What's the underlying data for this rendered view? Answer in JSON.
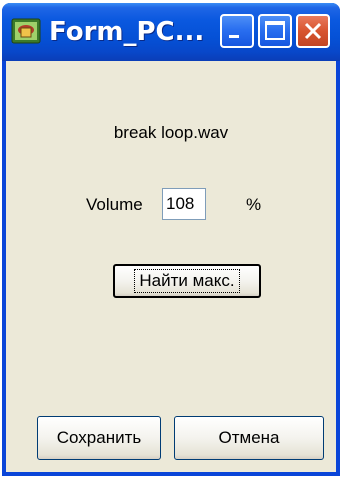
{
  "window": {
    "title": "Form_PC...",
    "accent_color": "#0a45d8",
    "client_color": "#ece9d8",
    "icons": [
      "app-icon",
      "minimize-icon",
      "maximize-icon",
      "close-icon"
    ]
  },
  "main": {
    "filename": "break loop.wav",
    "volume_label": "Volume",
    "volume_value": "108",
    "percent_label": "%",
    "find_max_label": "Найти макс."
  },
  "footer": {
    "save_label": "Сохранить",
    "cancel_label": "Отмена"
  }
}
